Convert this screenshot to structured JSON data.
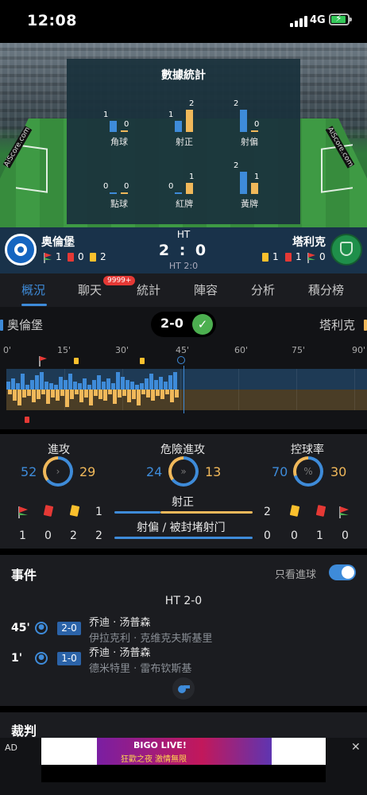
{
  "status_bar": {
    "time": "12:08",
    "network": "4G"
  },
  "hero": {
    "board_left": "AiScore.com",
    "board_right": "AiScore.com",
    "stats_title": "數據統計",
    "stats": [
      {
        "label": "角球",
        "home": "1",
        "away": "0",
        "home_value": 1,
        "away_value": 0
      },
      {
        "label": "射正",
        "home": "1",
        "away": "2",
        "home_value": 1,
        "away_value": 2
      },
      {
        "label": "射偏",
        "home": "2",
        "away": "0",
        "home_value": 2,
        "away_value": 0
      },
      {
        "label": "點球",
        "home": "0",
        "away": "0",
        "home_value": 0,
        "away_value": 0
      },
      {
        "label": "紅牌",
        "home": "0",
        "away": "1",
        "home_value": 0,
        "away_value": 1
      },
      {
        "label": "黃牌",
        "home": "2",
        "away": "1",
        "home_value": 2,
        "away_value": 1
      }
    ],
    "page_dots": 4,
    "active_dot": 2
  },
  "match": {
    "home": {
      "name": "奥倫堡",
      "corners": "1",
      "red": "0",
      "yellow": "2"
    },
    "away": {
      "name": "塔利克",
      "yellow": "1",
      "red": "1",
      "corners": "0"
    },
    "status": "HT",
    "score": "2 : 0",
    "ht_score": "HT 2:0"
  },
  "tabs": [
    {
      "label": "概況",
      "active": true
    },
    {
      "label": "聊天",
      "badge": "9999+"
    },
    {
      "label": "統計"
    },
    {
      "label": "陣容"
    },
    {
      "label": "分析"
    },
    {
      "label": "積分榜"
    }
  ],
  "score_row": {
    "home": "奥倫堡",
    "away": "塔利克",
    "score": "2-0",
    "check": "✓"
  },
  "timeline": {
    "ticks": [
      "0'",
      "15'",
      "30'",
      "45'",
      "60'",
      "75'",
      "90'"
    ]
  },
  "summary": {
    "attack": {
      "label": "進攻",
      "home": "52",
      "away": "29",
      "home_value": 52,
      "away_value": 29,
      "icon": "›"
    },
    "dangerous": {
      "label": "危險進攻",
      "home": "24",
      "away": "13",
      "home_value": 24,
      "away_value": 13,
      "icon": "»"
    },
    "possession": {
      "label": "控球率",
      "home": "70",
      "away": "30",
      "home_value": 70,
      "away_value": 30,
      "icon": "%"
    },
    "home_counts": [
      "1",
      "0",
      "2",
      "2"
    ],
    "away_counts": [
      "0",
      "0",
      "1",
      "0"
    ],
    "shots_on": {
      "label": "射正",
      "home": "1",
      "away": "2",
      "home_value": 1,
      "away_value": 2
    },
    "shots_off": {
      "label": "射偏 / 被封堵射门",
      "home": "2",
      "away": "0",
      "home_value": 2,
      "away_value": 0
    }
  },
  "events": {
    "title": "事件",
    "toggle_label": "只看進球",
    "toggle_on": true,
    "ht_label": "HT 2-0",
    "items": [
      {
        "minute": "45'",
        "score": "2-0",
        "scorer": "乔迪 · 汤普森",
        "assist": "伊拉克利 · 克维克夫斯基里"
      },
      {
        "minute": "1'",
        "score": "1-0",
        "scorer": "乔迪 · 汤普森",
        "assist": "德米特里 · 雷布钦斯基"
      }
    ]
  },
  "referee": {
    "title": "裁判"
  },
  "ad": {
    "label": "AD",
    "close": "✕",
    "brand": "BIGO LIVE!",
    "tagline": "狂歡之夜 激情無限"
  },
  "colors": {
    "home": "#3e8bd9",
    "away": "#f0b85a",
    "accent": "#3e8bd9"
  }
}
